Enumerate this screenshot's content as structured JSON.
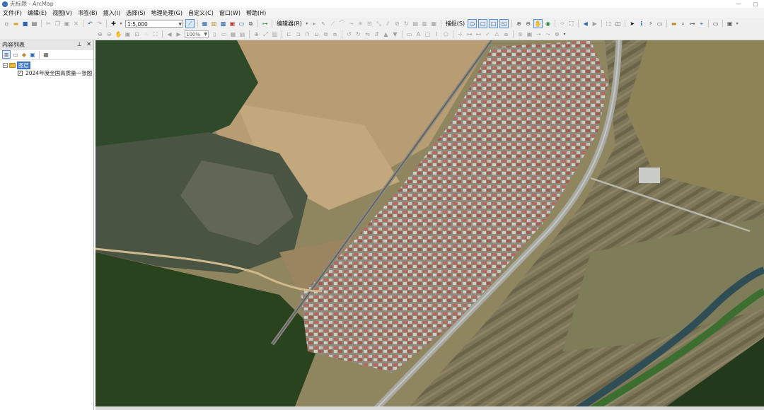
{
  "window": {
    "title": "无标题 - ArcMap"
  },
  "menu": [
    "文件(F)",
    "编辑(E)",
    "视图(V)",
    "书签(B)",
    "插入(I)",
    "选择(S)",
    "地理处理(G)",
    "自定义(C)",
    "窗口(W)",
    "帮助(H)"
  ],
  "toolbar": {
    "scale_value": "1:5,000",
    "editor_label": "编辑器(R)",
    "snapping_label": "捕捉(S)",
    "zoom_value": "100%"
  },
  "toc": {
    "title": "内容列表",
    "root_label": "图层",
    "layer_label": "2024年度全国高质量一张图",
    "layer_checked": "✓"
  },
  "colors": {
    "layer_selected": "#3a73c4",
    "folder": "#e8b83e",
    "road": "#a9a9a4",
    "river": "#2f4d55"
  }
}
